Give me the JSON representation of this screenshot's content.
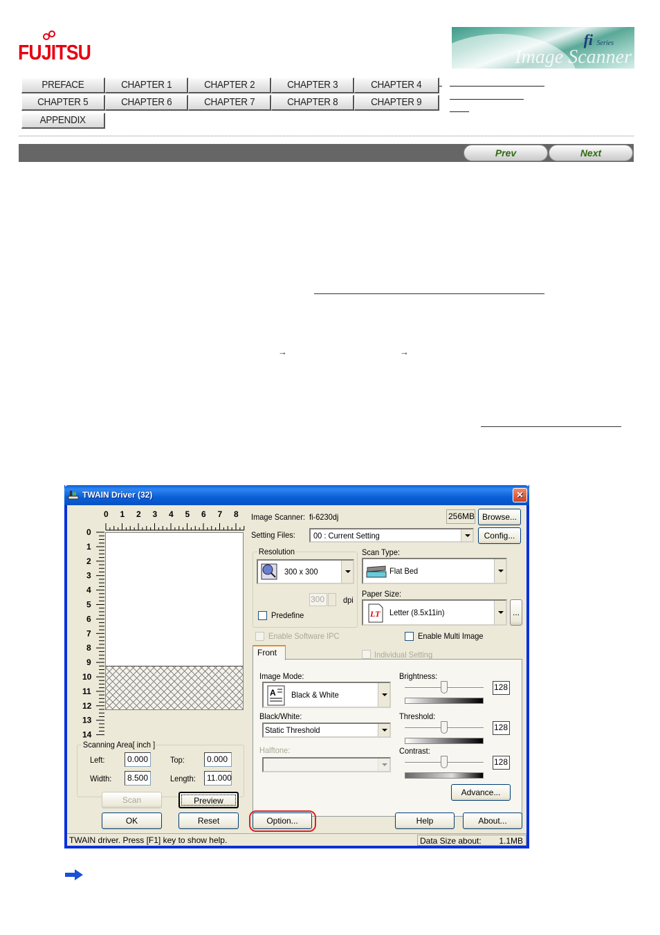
{
  "header": {
    "logo_text": "FUJITSU",
    "banner": {
      "brand": "fi",
      "series": "Series",
      "subtitle": "Image Scanner"
    }
  },
  "nav": {
    "row1": [
      "PREFACE",
      "CHAPTER 1",
      "CHAPTER 2",
      "CHAPTER 3",
      "CHAPTER 4"
    ],
    "row2": [
      "CHAPTER 5",
      "CHAPTER 6",
      "CHAPTER 7",
      "CHAPTER 8",
      "CHAPTER 9"
    ],
    "row3": [
      "APPENDIX"
    ],
    "prev_label": "Prev",
    "next_label": "Next"
  },
  "body": {
    "arrow_symbol": "→"
  },
  "dialog": {
    "title": "TWAIN Driver (32)",
    "close_symbol": "✕",
    "ruler": {
      "x_ticks": [
        "0",
        "1",
        "2",
        "3",
        "4",
        "5",
        "6",
        "7",
        "8"
      ],
      "y_ticks": [
        "0",
        "1",
        "2",
        "3",
        "4",
        "5",
        "6",
        "7",
        "8",
        "9",
        "10",
        "11",
        "12",
        "13",
        "14"
      ]
    },
    "scanning_area": {
      "title": "Scanning Area[ inch ]",
      "left_label": "Left:",
      "left_value": "0.000",
      "top_label": "Top:",
      "top_value": "0.000",
      "width_label": "Width:",
      "width_value": "8.500",
      "length_label": "Length:",
      "length_value": "11.000"
    },
    "image_scanner_label": "Image Scanner:",
    "image_scanner_value": "fi-6230dj",
    "memory": "256MB",
    "browse_label": "Browse...",
    "setting_files_label": "Setting Files:",
    "setting_files_value": "00 : Current Setting",
    "config_label": "Config...",
    "resolution": {
      "title": "Resolution",
      "value": "300 x 300",
      "dpi_value": "300",
      "dpi_label": "dpi",
      "predefine_label": "Predefine",
      "predefine_checked": false
    },
    "scan_type_label": "Scan Type:",
    "scan_type_value": "Flat Bed",
    "paper_size_label": "Paper Size:",
    "paper_size_value": "Letter (8.5x11in)",
    "paper_size_more": "...",
    "enable_ipc_label": "Enable Software IPC",
    "enable_ipc_checked": false,
    "enable_multi_label": "Enable Multi Image",
    "enable_multi_checked": false,
    "tab_front": "Front",
    "individual_setting_label": "Individual Setting",
    "individual_setting_checked": false,
    "image_mode_label": "Image Mode:",
    "image_mode_value": "Black & White",
    "bw_label": "Black/White:",
    "bw_value": "Static Threshold",
    "halftone_label": "Halftone:",
    "halftone_value": "",
    "brightness": {
      "label": "Brightness:",
      "value": "128",
      "level": 128,
      "max": 255
    },
    "threshold": {
      "label": "Threshold:",
      "value": "128",
      "level": 128,
      "max": 255
    },
    "contrast": {
      "label": "Contrast:",
      "value": "128",
      "level": 128,
      "max": 255
    },
    "advance_label": "Advance...",
    "scan_label": "Scan",
    "preview_label": "Preview",
    "ok_label": "OK",
    "reset_label": "Reset",
    "option_label": "Option...",
    "help_label": "Help",
    "about_label": "About...",
    "status_text": "TWAIN driver. Press [F1] key to show help.",
    "data_size_label": "Data Size about:",
    "data_size_value": "1.1MB"
  },
  "colors": {
    "fujitsu_red": "#e60012",
    "highlight_ring": "#e02020",
    "xp_title_blue": "#0a5fd8",
    "nav_arrow_blue": "#1a4fd8"
  }
}
